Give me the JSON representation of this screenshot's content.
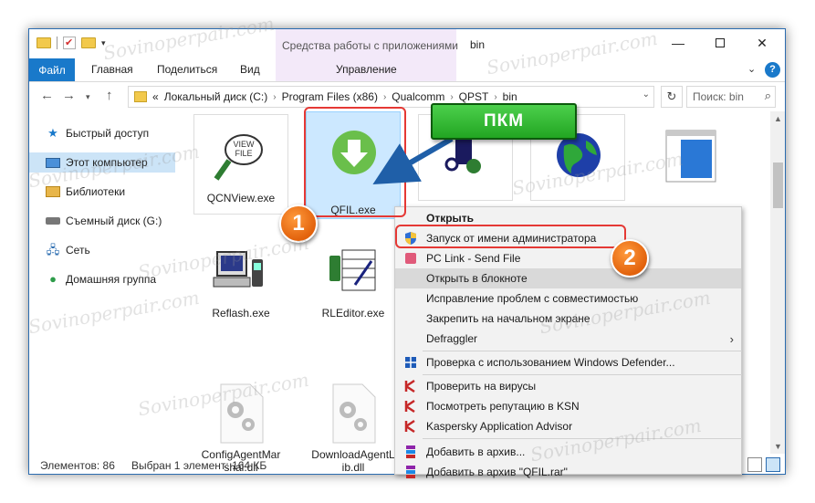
{
  "window": {
    "title": "bin",
    "tools_context": "Средства работы с приложениями",
    "help": "?"
  },
  "ribbon": {
    "tabs": [
      "Файл",
      "Главная",
      "Поделиться",
      "Вид",
      "Управление"
    ]
  },
  "address": {
    "prefix": "«",
    "crumbs": [
      "Локальный диск (C:)",
      "Program Files (x86)",
      "Qualcomm",
      "QPST",
      "bin"
    ],
    "search_placeholder": "Поиск: bin"
  },
  "sidebar": {
    "items": [
      {
        "label": "Быстрый доступ",
        "icon": "star-icon"
      },
      {
        "label": "Этот компьютер",
        "icon": "computer-icon",
        "selected": true
      },
      {
        "label": "Библиотеки",
        "icon": "library-icon"
      },
      {
        "label": "Съемный диск (G:)",
        "icon": "drive-icon"
      },
      {
        "label": "Сеть",
        "icon": "network-icon"
      },
      {
        "label": "Домашняя группа",
        "icon": "homegroup-icon"
      }
    ]
  },
  "files": [
    {
      "name": "QCNView.exe",
      "icon": "qcnview-icon"
    },
    {
      "name": "QFIL.exe",
      "icon": "qfil-icon",
      "selected": true
    },
    {
      "name": "",
      "icon": "qpst-phone-icon"
    },
    {
      "name": "",
      "icon": "globe-icon"
    },
    {
      "name": "",
      "icon": "window-icon"
    },
    {
      "name": "Reflash.exe",
      "icon": "reflash-icon"
    },
    {
      "name": "RLEditor.exe",
      "icon": "rleditor-icon"
    },
    {
      "name": "ConfigAgentMarshal.dll",
      "line1": "ConfigAgentMar",
      "line2": "shal.dll",
      "icon": "dll-gear-icon"
    },
    {
      "name": "DownloadAgentLib.dll",
      "line1": "DownloadAgentL",
      "line2": "ib.dll",
      "icon": "dll-gear-icon"
    }
  ],
  "context_menu": {
    "items": [
      {
        "label": "Открыть",
        "bold": true
      },
      {
        "label": "Запуск от имени администратора",
        "icon": "shield-icon"
      },
      {
        "label": "PC Link - Send File",
        "icon": "pclink-icon"
      },
      {
        "label": "Открыть в блокноте",
        "highlighted": true
      },
      {
        "label": "Исправление проблем с совместимостью"
      },
      {
        "label": "Закрепить на начальном экране"
      },
      {
        "label": "Defraggler",
        "submenu": true
      },
      {
        "label": "Проверка с использованием Windows Defender...",
        "icon": "defender-icon"
      },
      {
        "label": "Проверить на вирусы",
        "icon": "kaspersky-icon"
      },
      {
        "label": "Посмотреть репутацию в KSN",
        "icon": "kaspersky-icon"
      },
      {
        "label": "Kaspersky Application Advisor",
        "icon": "kaspersky-icon"
      },
      {
        "label": "Добавить в архив...",
        "icon": "winrar-icon"
      },
      {
        "label": "Добавить в архив \"QFIL.rar\"",
        "icon": "winrar-icon"
      }
    ]
  },
  "status": {
    "count": "Элементов: 86",
    "selected": "Выбран 1 элемент: 164 КБ"
  },
  "annotations": {
    "pkm": "ПКМ",
    "step1": "1",
    "step2": "2"
  },
  "watermark": "Sovinoperpair.com",
  "colors": {
    "accent": "#1979ca",
    "selection": "#cce8ff",
    "highlight_red": "#e53935",
    "badge_orange": "#e2620c",
    "pkm_green": "#22a522"
  }
}
